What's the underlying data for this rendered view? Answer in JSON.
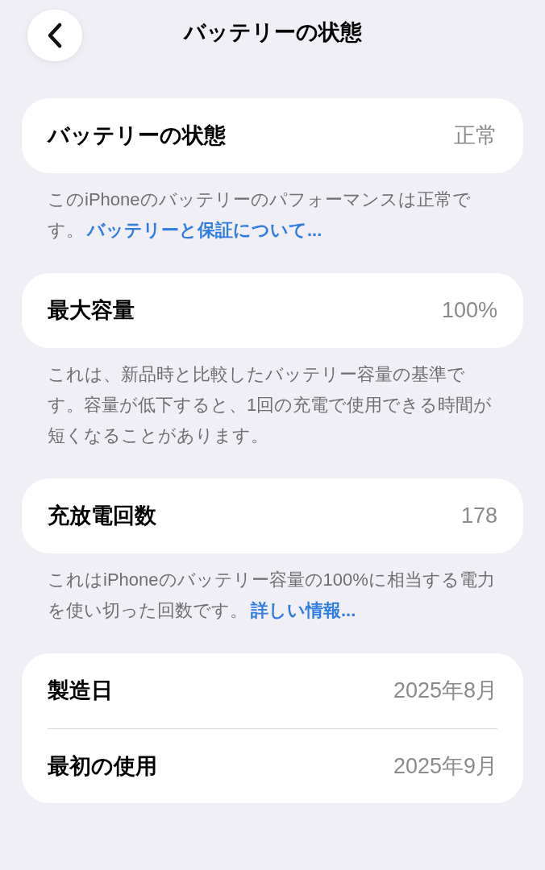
{
  "header": {
    "title": "バッテリーの状態"
  },
  "sections": [
    {
      "rows": [
        {
          "label": "バッテリーの状態",
          "value": "正常"
        }
      ],
      "footer": {
        "text": "このiPhoneのバッテリーのパフォーマンスは正常です。",
        "link": "バッテリーと保証について..."
      }
    },
    {
      "rows": [
        {
          "label": "最大容量",
          "value": "100%"
        }
      ],
      "footer": {
        "text": "これは、新品時と比較したバッテリー容量の基準です。容量が低下すると、1回の充電で使用できる時間が短くなることがあります。"
      }
    },
    {
      "rows": [
        {
          "label": "充放電回数",
          "value": "178"
        }
      ],
      "footer": {
        "text": "これはiPhoneのバッテリー容量の100%に相当する電力を使い切った回数です。",
        "link": "詳しい情報..."
      }
    },
    {
      "rows": [
        {
          "label": "製造日",
          "value": "2025年8月"
        },
        {
          "label": "最初の使用",
          "value": "2025年9月"
        }
      ]
    }
  ]
}
